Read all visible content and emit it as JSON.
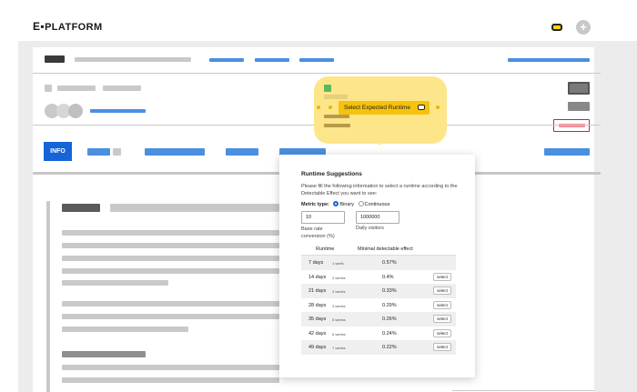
{
  "header": {
    "brand": "PLATFORM",
    "brand_mark": "E▪",
    "plus_label": "+"
  },
  "tabs": {
    "info_label": "INFO"
  },
  "callout": {
    "label": "Select Expected Runtime"
  },
  "popover": {
    "title": "Runtime Suggestions",
    "description": "Please fill the following information to select a runtime according to the Detectable Effect you want to see:",
    "metric_type_label": "Metric type:",
    "options": [
      "Binary",
      "Continuous"
    ],
    "selected_option": "Binary",
    "base_rate_value": "10",
    "daily_visitors_value": "1000000",
    "base_rate_label": "Base rate conversion (%)",
    "daily_visitors_label": "Daily visitors",
    "table": {
      "columns": [
        "Runtime",
        "Minimal detectable effect"
      ],
      "rows": [
        {
          "days": "7 days",
          "weeks": "1 week",
          "effect": "0.57%",
          "action": ""
        },
        {
          "days": "14 days",
          "weeks": "2 weeks",
          "effect": "0.4%",
          "action": "select"
        },
        {
          "days": "21 days",
          "weeks": "3 weeks",
          "effect": "0.33%",
          "action": "select"
        },
        {
          "days": "28 days",
          "weeks": "4 weeks",
          "effect": "0.29%",
          "action": "select"
        },
        {
          "days": "35 days",
          "weeks": "5 weeks",
          "effect": "0.26%",
          "action": "select"
        },
        {
          "days": "42 days",
          "weeks": "6 weeks",
          "effect": "0.24%",
          "action": "select"
        },
        {
          "days": "49 days",
          "weeks": "7 weeks",
          "effect": "0.22%",
          "action": "select"
        }
      ]
    }
  },
  "colors": {
    "accent": "#1565d8",
    "callout": "#fde58a",
    "callout_pill": "#f6c20d",
    "alert_border": "#d0202e",
    "alert_fill": "#f08a94"
  }
}
